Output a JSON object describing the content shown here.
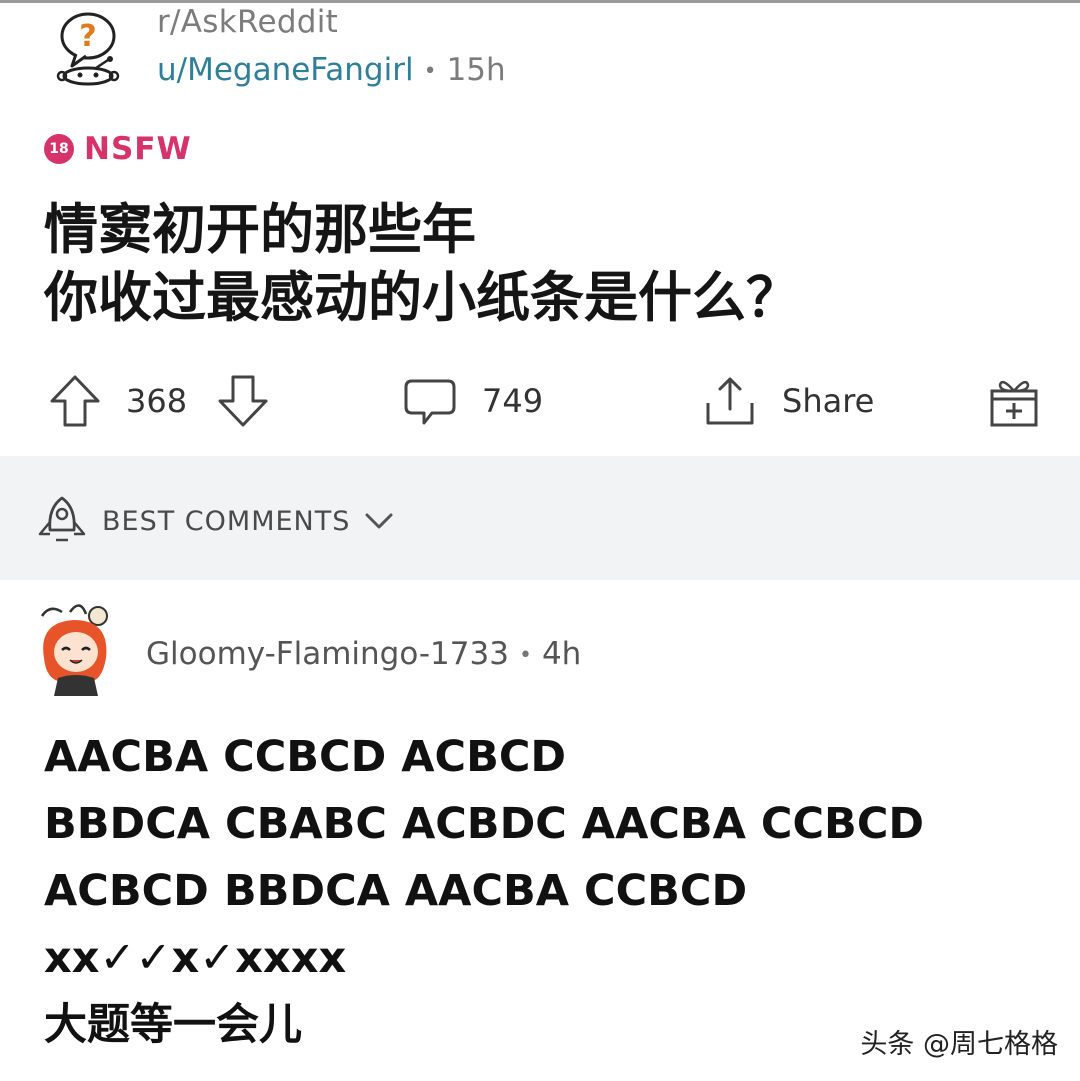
{
  "post": {
    "subreddit": "r/AskReddit",
    "author": "u/MeganeFangirl",
    "separator": "•",
    "age": "15h",
    "nsfw_badge": "18",
    "nsfw_label": "NSFW",
    "title_lines": [
      "情窦初开的那些年",
      "你收过最感动的小纸条是什么？"
    ]
  },
  "actions": {
    "upvotes": "368",
    "comments": "749",
    "share_label": "Share"
  },
  "sort": {
    "label": "BEST COMMENTS"
  },
  "comment": {
    "username": "Gloomy-Flamingo-1733",
    "separator": "•",
    "age": "4h",
    "lines": [
      "AACBA CCBCD ACBCD",
      "BBDCA CBABC ACBDC AACBA CCBCD",
      "ACBCD BBDCA AACBA CCBCD",
      "xx✓✓x✓xxxx",
      "大题等一会儿"
    ]
  },
  "watermark": "头条 @周七格格",
  "colors": {
    "nsfw": "#d5336a",
    "username_link": "#2f7f98",
    "sort_bg": "#f2f3f5"
  },
  "icons": [
    "askreddit-snoo-icon",
    "upvote-icon",
    "downvote-icon",
    "comment-icon",
    "share-icon",
    "gift-icon",
    "rocket-icon",
    "chevron-down-icon"
  ]
}
